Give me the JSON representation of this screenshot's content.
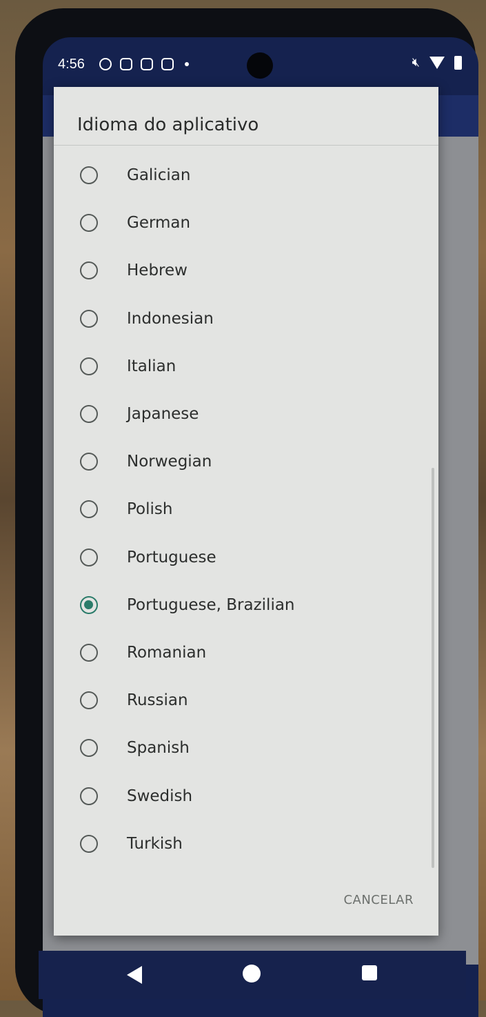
{
  "status_bar": {
    "time": "4:56",
    "left_icons": [
      "photo-notification-icon",
      "sim-card-icon",
      "shopping-bag-icon",
      "message-icon"
    ],
    "right_icons": [
      "mute-icon",
      "wifi-icon",
      "battery-icon"
    ]
  },
  "dialog": {
    "title": "Idioma do aplicativo",
    "options": [
      {
        "label": "Galician",
        "selected": false
      },
      {
        "label": "German",
        "selected": false
      },
      {
        "label": "Hebrew",
        "selected": false
      },
      {
        "label": "Indonesian",
        "selected": false
      },
      {
        "label": "Italian",
        "selected": false
      },
      {
        "label": "Japanese",
        "selected": false
      },
      {
        "label": "Norwegian",
        "selected": false
      },
      {
        "label": "Polish",
        "selected": false
      },
      {
        "label": "Portuguese",
        "selected": false
      },
      {
        "label": "Portuguese, Brazilian",
        "selected": true
      },
      {
        "label": "Romanian",
        "selected": false
      },
      {
        "label": "Russian",
        "selected": false
      },
      {
        "label": "Spanish",
        "selected": false
      },
      {
        "label": "Swedish",
        "selected": false
      },
      {
        "label": "Turkish",
        "selected": false
      }
    ],
    "cancel_label": "CANCELAR"
  },
  "colors": {
    "accent": "#2b7c6a",
    "dialog_bg": "#e3e4e2",
    "appbar": "#1d2d66"
  },
  "nav_bar": {
    "buttons": [
      "back-icon",
      "home-icon",
      "recents-icon"
    ]
  }
}
